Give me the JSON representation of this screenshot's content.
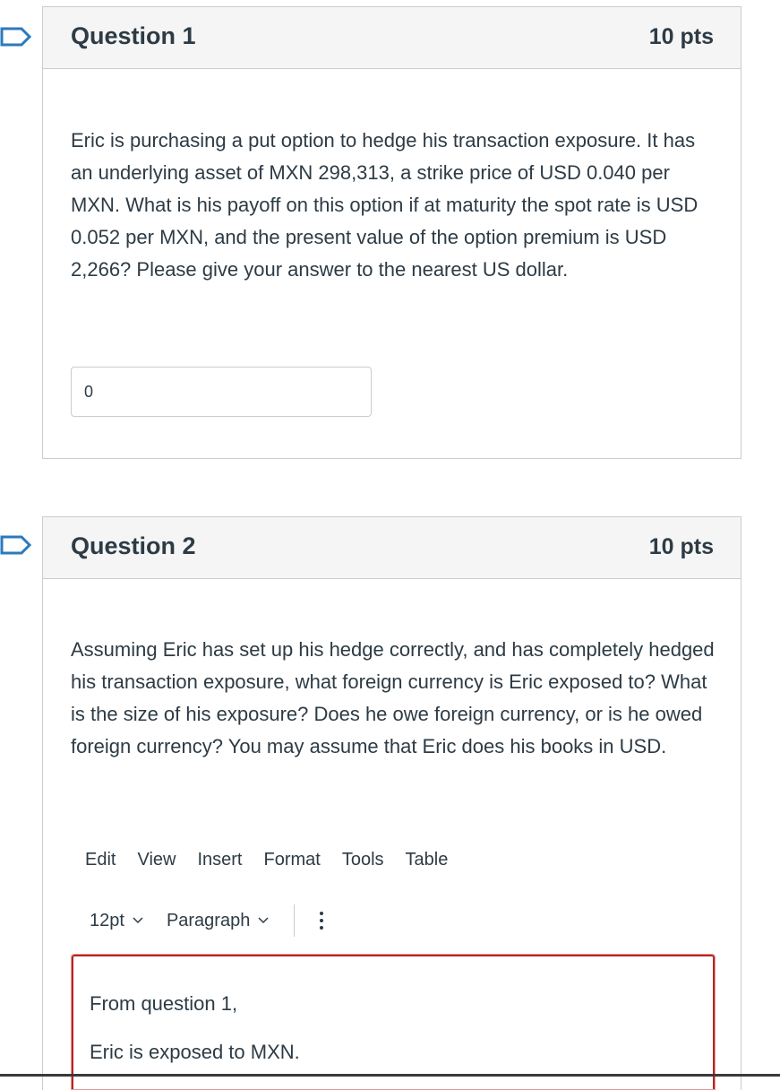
{
  "questions": [
    {
      "title": "Question 1",
      "points": "10 pts",
      "text": "Eric is purchasing a put option to hedge his transaction exposure. It has an underlying asset of MXN 298,313, a strike price of USD 0.040 per MXN. What is his payoff on this option if at maturity the spot rate is USD 0.052 per MXN, and the present value of the option premium is USD 2,266? Please give your answer to the nearest US dollar.",
      "answer_value": "0"
    },
    {
      "title": "Question 2",
      "points": "10 pts",
      "text": "Assuming Eric has set up his hedge correctly, and has completely hedged his transaction exposure, what foreign currency is Eric exposed to? What is the size of his exposure? Does he owe foreign currency, or is he owed foreign currency? You may assume that Eric does his books in USD."
    }
  ],
  "editor": {
    "menu": [
      "Edit",
      "View",
      "Insert",
      "Format",
      "Tools",
      "Table"
    ],
    "font_size": "12pt",
    "block_format": "Paragraph",
    "content": [
      "From question 1,",
      "Eric is exposed to MXN."
    ]
  },
  "colors": {
    "flag": "#2b7abc",
    "header_bg": "#f5f5f5",
    "border": "#c7cdd1",
    "editor_border": "#b3261e"
  },
  "icons": {
    "flag": "bookmark-flag-icon",
    "chevron": "chevron-down-icon",
    "more": "kebab-menu-icon"
  }
}
